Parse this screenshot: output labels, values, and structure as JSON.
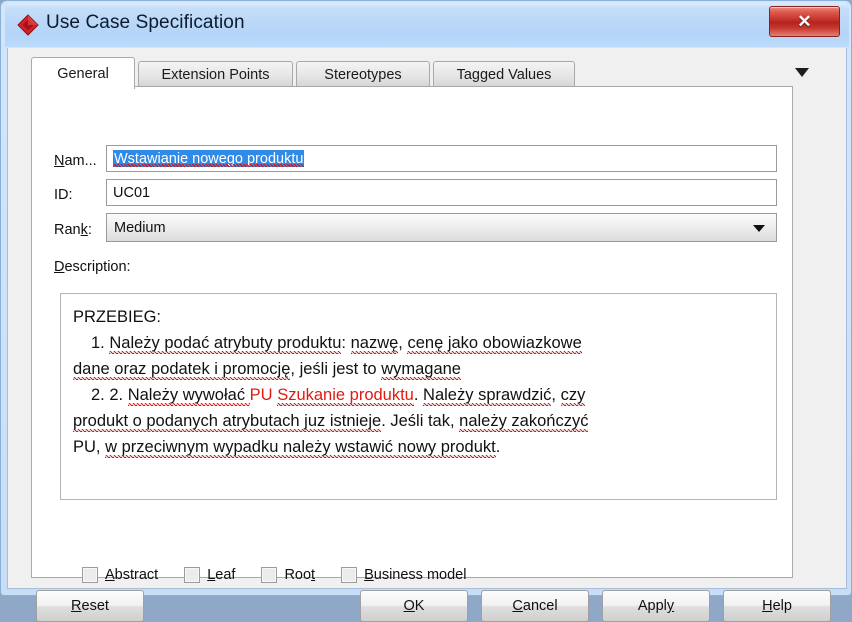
{
  "window": {
    "title": "Use Case Specification",
    "icon": "diamond-icon",
    "accent_color": "#b4d4f8",
    "close_label": "✕"
  },
  "tabs": [
    {
      "label": "General",
      "active": true
    },
    {
      "label": "Extension Points",
      "active": false
    },
    {
      "label": "Stereotypes",
      "active": false
    },
    {
      "label": "Tagged Values",
      "active": false
    }
  ],
  "tab_overflow_icon": "chevron-down-icon",
  "form": {
    "name": {
      "label": "Nam...",
      "label_mnemonic": "N",
      "value": "Wstawianie nowego produktu",
      "selected": true
    },
    "id": {
      "label": "ID:",
      "value": "UC01"
    },
    "rank": {
      "label_before": "Ran",
      "label_mnemonic": "k",
      "label_after": ":",
      "value": "Medium",
      "options": [
        "Medium"
      ]
    },
    "description": {
      "label_mnemonic": "D",
      "label_rest": "escription:",
      "lines": [
        {
          "indent": 0,
          "segments": [
            {
              "text": "PRZEBIEG:",
              "spell": false,
              "red": false
            }
          ]
        },
        {
          "indent": 1,
          "segments": [
            {
              "text": "1.  ",
              "spell": false,
              "red": false
            },
            {
              "text": "Należy podać atrybuty produktu",
              "spell": true,
              "red": false
            },
            {
              "text": ": ",
              "spell": false,
              "red": false
            },
            {
              "text": "nazwę",
              "spell": true,
              "red": false
            },
            {
              "text": ", ",
              "spell": false,
              "red": false
            },
            {
              "text": "cenę jako obowiazkowe",
              "spell": true,
              "red": false
            }
          ]
        },
        {
          "indent": 0,
          "segments": [
            {
              "text": "dane oraz podatek i promocję",
              "spell": true,
              "red": false
            },
            {
              "text": ", ",
              "spell": false,
              "red": false
            },
            {
              "text": "jeśli jest to ",
              "spell": false,
              "red": false
            },
            {
              "text": "wymagane",
              "spell": true,
              "red": false
            }
          ]
        },
        {
          "indent": 1,
          "segments": [
            {
              "text": "2.  2. ",
              "spell": false,
              "red": false
            },
            {
              "text": "Należy wywołać ",
              "spell": true,
              "red": false
            },
            {
              "text": "PU ",
              "spell": false,
              "red": true
            },
            {
              "text": "Szukanie produktu",
              "spell": true,
              "red": true
            },
            {
              "text": ". ",
              "spell": false,
              "red": false
            },
            {
              "text": "Należy sprawdzić",
              "spell": true,
              "red": false
            },
            {
              "text": ", ",
              "spell": false,
              "red": false
            },
            {
              "text": "czy",
              "spell": true,
              "red": false
            }
          ]
        },
        {
          "indent": 0,
          "segments": [
            {
              "text": "produkt o podanych atrybutach juz istnieje",
              "spell": true,
              "red": false
            },
            {
              "text": ". Jeśli tak, ",
              "spell": false,
              "red": false
            },
            {
              "text": "należy zakończyć",
              "spell": true,
              "red": false
            }
          ]
        },
        {
          "indent": 0,
          "segments": [
            {
              "text": "PU, ",
              "spell": false,
              "red": false
            },
            {
              "text": "w przeciwnym wypadku należy wstawić nowy produkt",
              "spell": true,
              "red": false
            },
            {
              "text": ".",
              "spell": false,
              "red": false
            }
          ]
        }
      ]
    }
  },
  "checkboxes": [
    {
      "mnemonic": "A",
      "rest": "bstract",
      "checked": false,
      "prefix": ""
    },
    {
      "mnemonic": "L",
      "rest": "eaf",
      "checked": false,
      "prefix": ""
    },
    {
      "mnemonic": "t",
      "rest": "",
      "checked": false,
      "prefix": "Roo"
    },
    {
      "mnemonic": "B",
      "rest": "usiness model",
      "checked": false,
      "prefix": ""
    }
  ],
  "buttons": [
    {
      "mnemonic": "R",
      "prefix": "",
      "rest": "eset"
    },
    {
      "mnemonic": "O",
      "prefix": "",
      "rest": "K"
    },
    {
      "mnemonic": "C",
      "prefix": "",
      "rest": "ancel"
    },
    {
      "mnemonic": "y",
      "prefix": "Appl",
      "rest": ""
    },
    {
      "mnemonic": "H",
      "prefix": "",
      "rest": "elp"
    }
  ]
}
